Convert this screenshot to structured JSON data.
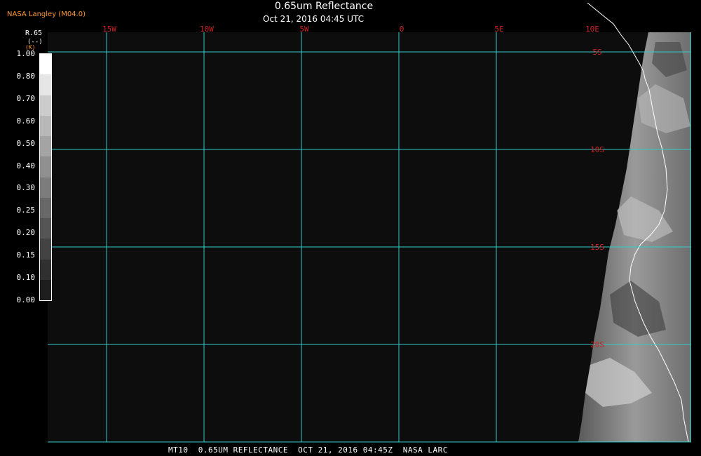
{
  "header": {
    "producer": "NASA Langley (M04.0)",
    "title": "0.65um Reflectance",
    "subtitle": "Oct 21, 2016 04:45 UTC"
  },
  "legend": {
    "variable": "R.65",
    "unit": "(--)",
    "corner": "(K)",
    "ticks": [
      "1.00",
      "0.80",
      "0.70",
      "0.60",
      "0.50",
      "0.40",
      "0.30",
      "0.25",
      "0.20",
      "0.15",
      "0.10",
      "0.00"
    ],
    "colors": [
      "#ffffff",
      "#e6e6e6",
      "#cccccc",
      "#b8b8b8",
      "#a4a4a4",
      "#909090",
      "#7c7c7c",
      "#686868",
      "#555555",
      "#434343",
      "#303030",
      "#1e1e1e"
    ]
  },
  "map": {
    "longitudes": [
      "15W",
      "10W",
      "5W",
      "0",
      "5E",
      "10E"
    ],
    "latitudes": [
      "5S",
      "10S",
      "15S",
      "20S"
    ],
    "grid_color": "#33cccc",
    "label_color": "#cc2222",
    "coast_color": "#ffffff"
  },
  "footer": "MT10  0.65UM REFLECTANCE  OCT 21, 2016 04:45Z  NASA LARC"
}
